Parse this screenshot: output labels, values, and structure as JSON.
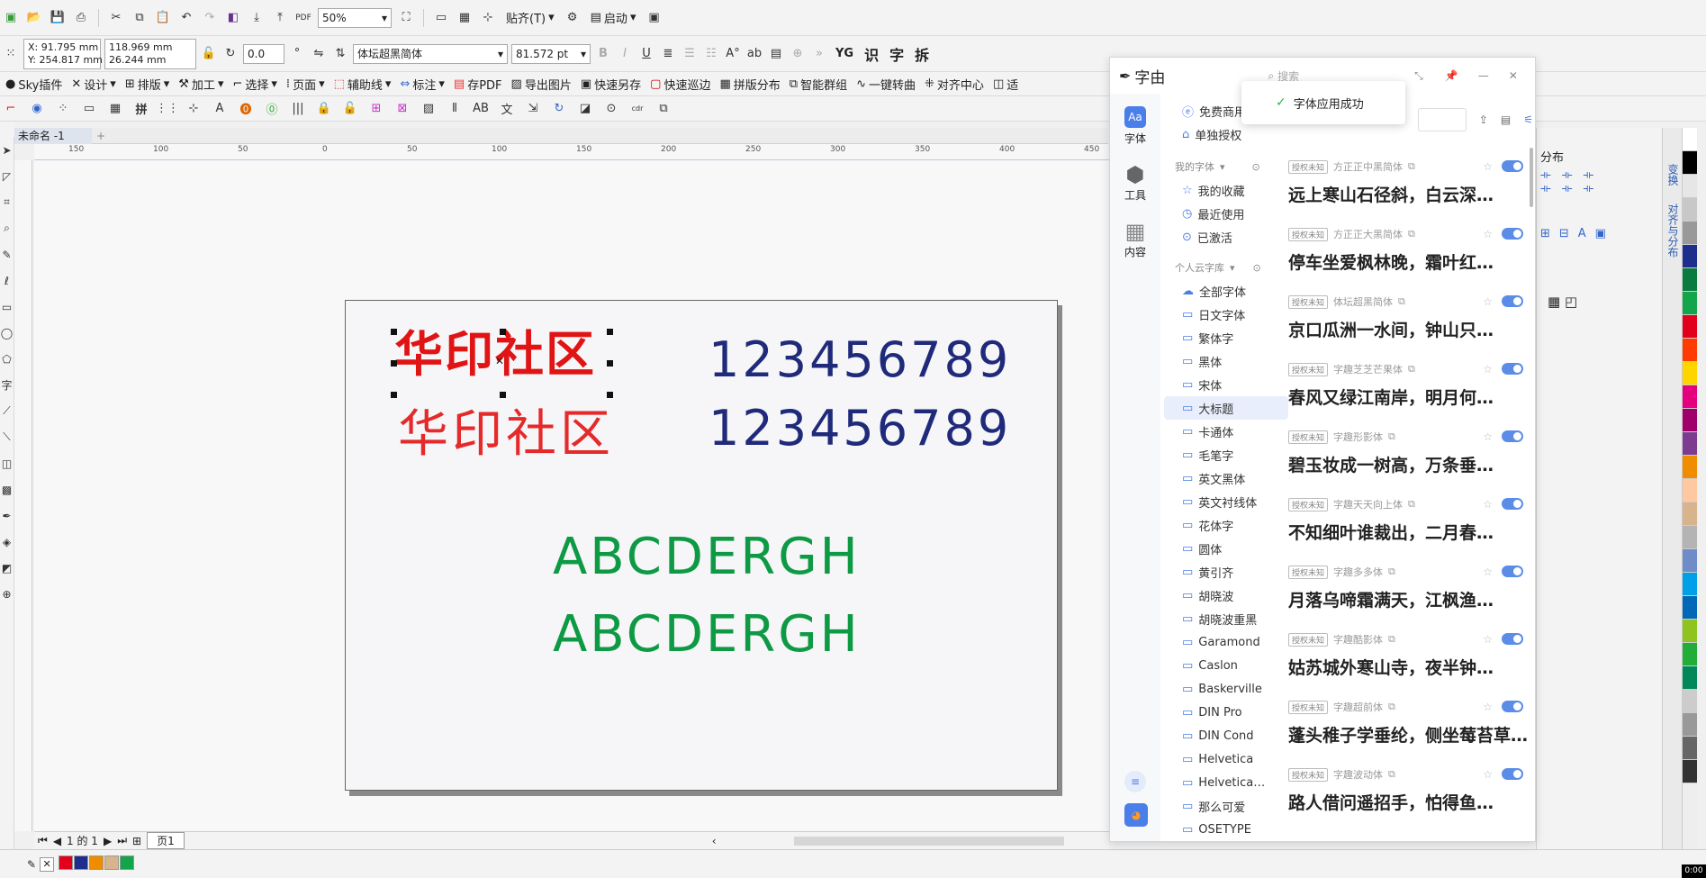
{
  "toolbar1": {
    "zoom": "50%",
    "snap": "贴齐(T)",
    "launch": "启动"
  },
  "propbar": {
    "x": "X: 91.795 mm",
    "y": "Y: 254.817 mm",
    "w": "118.969 mm",
    "h": "26.244 mm",
    "angle": "0.0",
    "font_name": "体坛超黑简体",
    "font_size": "81.572 pt",
    "bold": "B",
    "italic": "I",
    "underline": "U",
    "extra": [
      "YG",
      "识",
      "字",
      "拆"
    ]
  },
  "plugin_bar": [
    "Sky插件",
    "设计",
    "排版",
    "加工",
    "选择",
    "页面",
    "辅助线",
    "标注",
    "存PDF",
    "导出图片",
    "快速另存",
    "快速巡边",
    "拼版分布",
    "智能群组",
    "一键转曲",
    "对齐中心",
    "适"
  ],
  "doc_tab": "未命名 -1",
  "ruler_h": [
    "150",
    "100",
    "50",
    "0",
    "50",
    "100",
    "150",
    "200",
    "250",
    "300",
    "350",
    "400",
    "450"
  ],
  "canvas": {
    "red_bold": "华印社区",
    "red_thin": "华印社区",
    "num1": "123456789",
    "num2": "123456789",
    "abc1": "ABCDERGH",
    "abc2": "ABCDERGH"
  },
  "page_nav": {
    "count": "1 的 1",
    "page": "页1"
  },
  "font_panel": {
    "title": "字由",
    "search_placeholder": "搜索",
    "toast": "字体应用成功",
    "nav": [
      {
        "icon": "Aa",
        "label": "字体"
      },
      {
        "icon": "⬢",
        "label": "工具"
      },
      {
        "icon": "▦",
        "label": "内容"
      }
    ],
    "top_links": [
      "免费商用",
      "单独授权"
    ],
    "my_fonts": {
      "title": "我的字体",
      "items": [
        "我的收藏",
        "最近使用",
        "已激活"
      ]
    },
    "cloud": {
      "title": "个人云字库",
      "items": [
        "全部字体",
        "日文字体",
        "繁体字",
        "黑体",
        "宋体",
        "大标题",
        "卡通体",
        "毛笔字",
        "英文黑体",
        "英文衬线体",
        "花体字",
        "圆体",
        "黄引齐",
        "胡晓波",
        "胡晓波重黑",
        "Garamond",
        "Caslon",
        "Baskerville",
        "DIN Pro",
        "DIN Cond",
        "Helvetica",
        "Helvetica…",
        "那么可爱",
        "OSETYPE"
      ]
    },
    "fonts": [
      {
        "tag": "授权未知",
        "name": "方正正中黑简体",
        "preview": "远上寒山石径斜，白云深…"
      },
      {
        "tag": "授权未知",
        "name": "方正正大黑简体",
        "preview": "停车坐爱枫林晚，霜叶红…"
      },
      {
        "tag": "授权未知",
        "name": "体坛超黑简体",
        "preview": "京口瓜洲一水间，钟山只…"
      },
      {
        "tag": "授权未知",
        "name": "字趣芝芝芒果体",
        "preview": "春风又绿江南岸，明月何…"
      },
      {
        "tag": "授权未知",
        "name": "字趣形影体",
        "preview": "碧玉妆成一树高，万条垂…"
      },
      {
        "tag": "授权未知",
        "name": "字趣天天向上体",
        "preview": "不知细叶谁裁出，二月春…"
      },
      {
        "tag": "授权未知",
        "name": "字趣多多体",
        "preview": "月落乌啼霜满天，江枫渔…"
      },
      {
        "tag": "授权未知",
        "name": "字趣酷影体",
        "preview": "姑苏城外寒山寺，夜半钟…"
      },
      {
        "tag": "授权未知",
        "name": "字趣超前体",
        "preview": "蓬头稚子学垂纶，侧坐莓苔草…"
      },
      {
        "tag": "授权未知",
        "name": "字趣波动体",
        "preview": "路人借问遥招手，怕得鱼…"
      }
    ]
  },
  "right_dock": {
    "title1": "分布",
    "vtab1": "变换",
    "vtab2": "对齐与分布"
  },
  "palette": [
    "#ffffff",
    "#000000",
    "#e6e6e6",
    "#c8c8c8",
    "#999999",
    "#1e2e8c",
    "#0a7b3e",
    "#12a54a",
    "#e3001b",
    "#ff3b00",
    "#ffd500",
    "#e4007f",
    "#a0006a",
    "#7e3c91",
    "#f08c00",
    "#ffc8a0",
    "#d8b48c",
    "#b4b4b4",
    "#6e8cc8",
    "#00a0e9",
    "#0068b7",
    "#8fc31f",
    "#22ac38",
    "#00885a",
    "#cccccc",
    "#999999",
    "#666666",
    "#333333"
  ],
  "bottom_swatches": [
    "#e3001b",
    "#1e2e8c",
    "#f08c00",
    "#d8b48c",
    "#12a54a"
  ],
  "clock": "0:00"
}
